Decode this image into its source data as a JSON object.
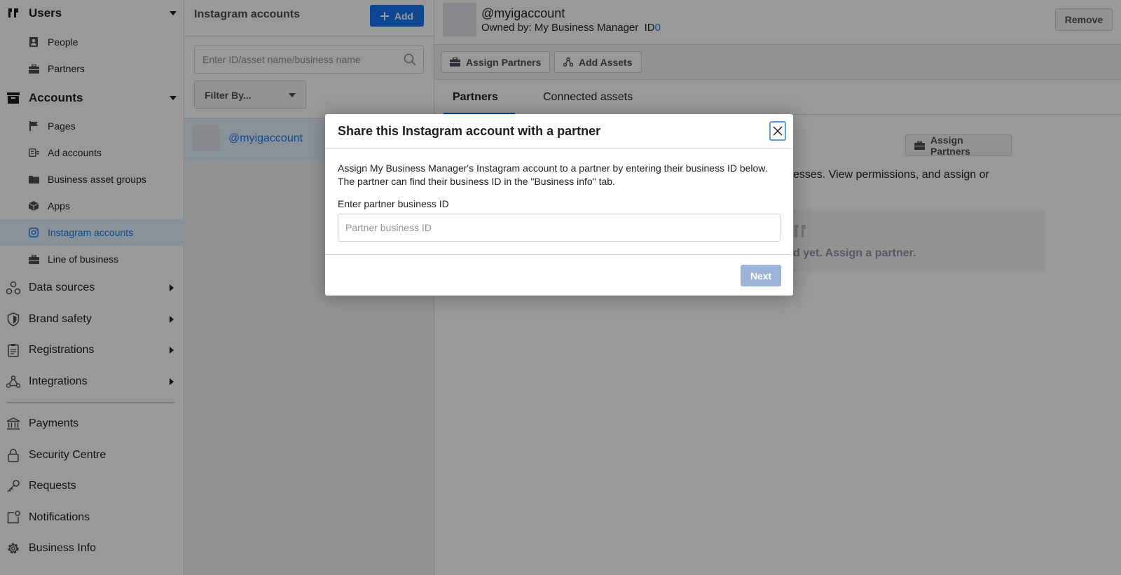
{
  "sidebar": {
    "users": {
      "label": "Users",
      "children": [
        "People",
        "Partners"
      ]
    },
    "accounts": {
      "label": "Accounts",
      "children": [
        "Pages",
        "Ad accounts",
        "Business asset groups",
        "Apps",
        "Instagram accounts",
        "Line of business"
      ]
    },
    "sections": [
      "Data sources",
      "Brand safety",
      "Registrations",
      "Integrations"
    ],
    "bottom": [
      "Payments",
      "Security Centre",
      "Requests",
      "Notifications",
      "Business Info"
    ]
  },
  "list": {
    "title": "Instagram accounts",
    "add_label": "Add",
    "search_placeholder": "Enter ID/asset name/business name",
    "filter_label": "Filter By...",
    "items": [
      "@myigaccount"
    ]
  },
  "detail": {
    "account_name": "@myigaccount",
    "owned_by": "Owned by: My Business Manager",
    "id_label": "ID",
    "id_value": "0",
    "remove_label": "Remove",
    "toolbar": {
      "assign_partners": "Assign Partners",
      "add_assets": "Add Assets"
    },
    "tabs": [
      "Partners",
      "Connected assets"
    ],
    "assign_partners_btn": "Assign Partners",
    "desc_fragment": "esses. View permissions, and assign or",
    "empty_fragment": "d yet. Assign a partner."
  },
  "modal": {
    "title": "Share this Instagram account with a partner",
    "body": "Assign My Business Manager's Instagram account to a partner by entering their business ID below. The partner can find their business ID in the \"Business info\" tab.",
    "field_label": "Enter partner business ID",
    "field_placeholder": "Partner business ID",
    "field_value": "",
    "next_label": "Next"
  },
  "colors": {
    "accent": "#1877f2",
    "disabled_button": "#9cb4d8",
    "selected_bg": "#e7f3ff"
  }
}
